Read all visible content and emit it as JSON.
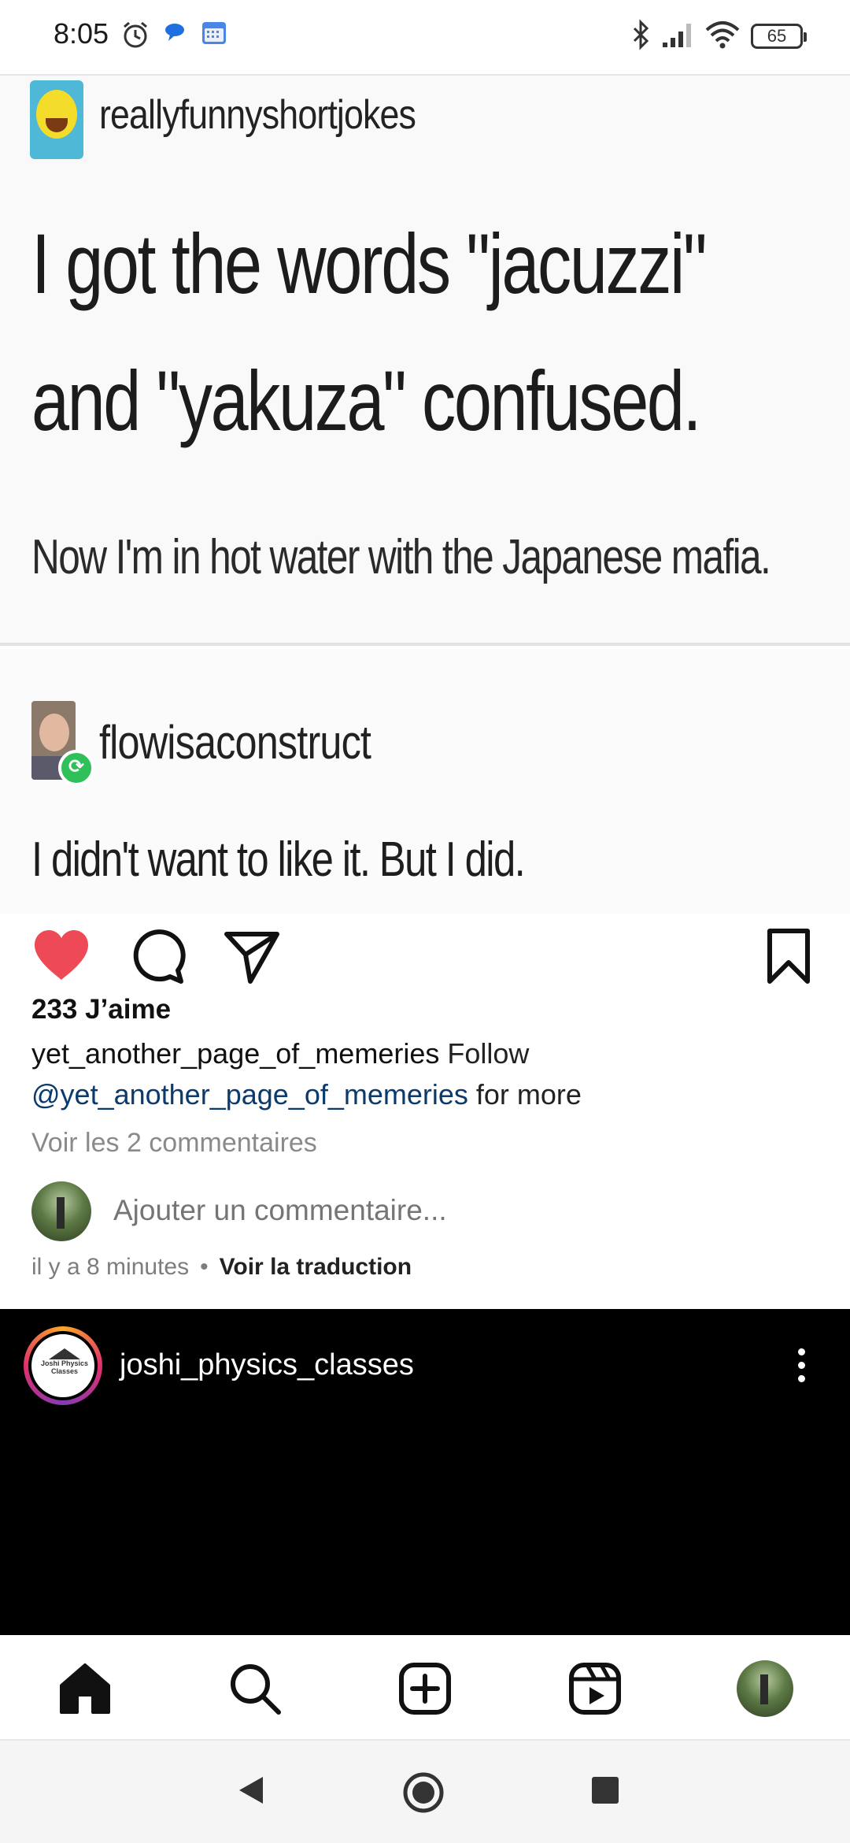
{
  "status_bar": {
    "time": "8:05",
    "battery": "65",
    "icons": [
      "alarm-icon",
      "chat-bubble-icon",
      "calendar-icon",
      "bluetooth-icon",
      "signal-icon",
      "wifi-icon",
      "battery-icon"
    ]
  },
  "post_media": {
    "top_post": {
      "blog_name": "reallyfunnyshortjokes",
      "joke_line_1": "I got the words \"jacuzzi\"",
      "joke_line_2": "and \"yakuza\" confused.",
      "punchline": "Now I'm in hot water with the Japanese mafia."
    },
    "reblog": {
      "blog_name": "flowisaconstruct",
      "comment": "I didn't want to like it. But I did."
    }
  },
  "actions": {
    "like_icon": "heart-filled-icon",
    "comment_icon": "comment-icon",
    "share_icon": "send-icon",
    "save_icon": "bookmark-icon",
    "like_color": "#ed4956"
  },
  "post": {
    "likes": "233 J’aime",
    "caption_username": "yet_another_page_of_memeries",
    "caption_text_1": " Follow ",
    "caption_mention": "@yet_another_page_of_memeries",
    "caption_text_2": " for more",
    "view_comments": "Voir les 2 commentaires",
    "comment_placeholder": "Ajouter un commentaire...",
    "timestamp": "il y a 8 minutes",
    "separator": "•",
    "translate": "Voir la traduction"
  },
  "next_post": {
    "username": "joshi_physics_classes",
    "avatar_text": "Joshi Physics Classes"
  },
  "bottom_nav": {
    "items": [
      "home-icon",
      "search-icon",
      "create-icon",
      "reels-icon",
      "profile-avatar"
    ]
  },
  "system_nav": {
    "items": [
      "back-icon",
      "home-circle-icon",
      "recents-icon"
    ]
  }
}
